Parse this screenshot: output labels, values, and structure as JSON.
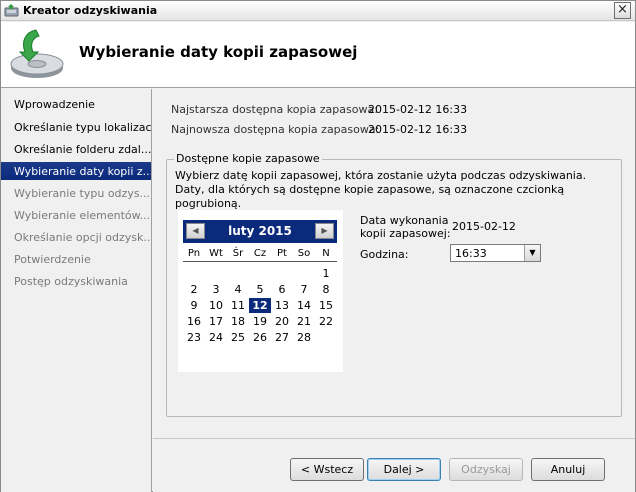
{
  "window": {
    "title": "Kreator odzyskiwania",
    "close_label": "×"
  },
  "header": {
    "title": "Wybieranie daty kopii zapasowej",
    "icon": "backup-disk-icon"
  },
  "nav": {
    "items": [
      {
        "label": "Wprowadzenie",
        "state": "done"
      },
      {
        "label": "Określanie typu lokalizacji",
        "state": "done"
      },
      {
        "label": "Określanie folderu zdal...",
        "state": "done"
      },
      {
        "label": "Wybieranie daty kopii z...",
        "state": "active"
      },
      {
        "label": "Wybieranie typu odzys...",
        "state": "todo"
      },
      {
        "label": "Wybieranie elementów...",
        "state": "todo"
      },
      {
        "label": "Określanie opcji odzysk...",
        "state": "todo"
      },
      {
        "label": "Potwierdzenie",
        "state": "todo"
      },
      {
        "label": "Postęp odzyskiwania",
        "state": "todo"
      }
    ]
  },
  "info": {
    "oldest_label": "Najstarsza dostępna kopia zapasowa:",
    "oldest_value": "2015-02-12 16:33",
    "newest_label": "Najnowsza dostępna kopia zapasowa:",
    "newest_value": "2015-02-12 16:33"
  },
  "group": {
    "title": "Dostępne kopie zapasowe",
    "description": "Wybierz datę kopii zapasowej, która zostanie użyta podczas odzyskiwania. Daty, dla których są dostępne kopie zapasowe, są oznaczone czcionką pogrubioną."
  },
  "calendar": {
    "month_label": "luty 2015",
    "prev_glyph": "◀",
    "next_glyph": "▶",
    "weekdays": [
      "Pn",
      "Wt",
      "Śr",
      "Cz",
      "Pt",
      "So",
      "N"
    ],
    "weeks": [
      [
        "",
        "",
        "",
        "",
        "",
        "",
        "1"
      ],
      [
        "2",
        "3",
        "4",
        "5",
        "6",
        "7",
        "8"
      ],
      [
        "9",
        "10",
        "11",
        "12",
        "13",
        "14",
        "15"
      ],
      [
        "16",
        "17",
        "18",
        "19",
        "20",
        "21",
        "22"
      ],
      [
        "23",
        "24",
        "25",
        "26",
        "27",
        "28",
        ""
      ]
    ],
    "selected_day": "12"
  },
  "fields": {
    "backup_date_label_1": "Data wykonania",
    "backup_date_label_2": "kopii zapasowej:",
    "backup_date_value": "2015-02-12",
    "time_label": "Godzina:",
    "time_value": "16:33",
    "dropdown_glyph": "▼"
  },
  "buttons": {
    "back": "< Wstecz",
    "next": "Dalej >",
    "recover": "Odzyskaj",
    "cancel": "Anuluj"
  },
  "colors": {
    "accent": "#0b2a7c",
    "disabled_text": "#7a7a7a"
  }
}
